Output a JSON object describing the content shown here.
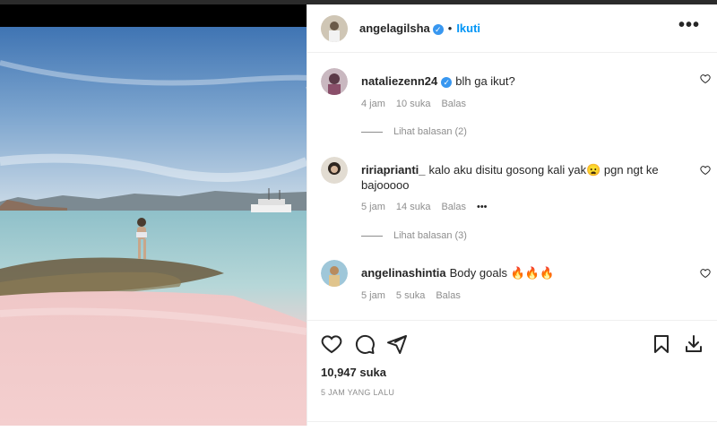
{
  "post": {
    "username": "angelagilsha",
    "follow_label": "Ikuti",
    "dot": "•",
    "more_label": "•••"
  },
  "comments": [
    {
      "username": "nataliezenn24",
      "verified": true,
      "text": "blh ga ikut?",
      "time": "4 jam",
      "likes": "10 suka",
      "reply": "Balas",
      "view_replies": "Lihat balasan (2)"
    },
    {
      "username": "ririaprianti_",
      "verified": false,
      "text": "kalo aku disitu gosong kali yak😦 pgn ngt ke bajooooo",
      "time": "5 jam",
      "likes": "14 suka",
      "reply": "Balas",
      "options": "•••",
      "view_replies": "Lihat balasan (3)"
    },
    {
      "username": "angelinashintia",
      "verified": false,
      "text": "Body goals 🔥🔥🔥",
      "time": "5 jam",
      "likes": "5 suka",
      "reply": "Balas"
    }
  ],
  "footer": {
    "likes": "10,947 suka",
    "time_ago": "5 JAM YANG LALU"
  },
  "colors": {
    "accent": "#0095f6",
    "verified": "#3897f0",
    "muted": "#8e8e8e"
  }
}
